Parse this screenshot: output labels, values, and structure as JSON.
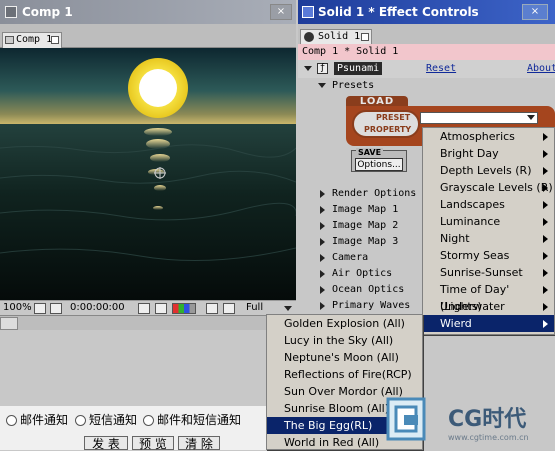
{
  "comp_window": {
    "title": "Comp 1",
    "tab_label": "Comp 1",
    "status": {
      "zoom": "100%",
      "timecode": "0:00:00:00",
      "resolution": "Full"
    }
  },
  "effect_controls": {
    "title": "Solid 1 * Effect Controls",
    "tab_label": "Solid 1",
    "comp_line": "Comp 1 * Solid 1",
    "effect_name": "Psunami",
    "reset_link": "Reset",
    "about_link": "About",
    "presets_label": "Presets",
    "preset_widget": {
      "load_label": "LOAD",
      "preset_label": "PRESET",
      "property_label": "PROPERTY",
      "save_label": "SAVE",
      "options_button": "Options..."
    },
    "properties": [
      "Render Options",
      "Image Map 1",
      "Image Map 2",
      "Image Map 3",
      "Camera",
      "Air Optics",
      "Ocean Optics",
      "Primary Waves"
    ]
  },
  "preset_menu": {
    "items": [
      "Atmospherics",
      "Bright Day",
      "Depth Levels (R)",
      "Grayscale Levels (R)",
      "Landscapes",
      "Luminance",
      "Night",
      "Stormy Seas",
      "Sunrise-Sunset",
      "Time of Day' (Lights)",
      "Underwater",
      "Wierd"
    ],
    "selected": "Wierd"
  },
  "wierd_submenu": {
    "items": [
      "Golden Explosion (All)",
      "Lucy in the Sky (All)",
      "Neptune's Moon (All)",
      "Reflections of Fire(RCP)",
      "Sun Over Mordor (All)",
      "Sunrise Bloom (All)",
      "The Big Egg(RL)",
      "World in Red (All)"
    ],
    "selected": "The Big Egg(RL)"
  },
  "notify": {
    "options": [
      "邮件通知",
      "短信通知",
      "邮件和短信通知"
    ],
    "buttons": [
      "发 表",
      "预 览",
      "清 除"
    ]
  },
  "watermark": {
    "brand": "CG时代",
    "url": "www.cgtime.com.cn"
  },
  "colors": {
    "ec_title": "#1e3c9a",
    "menu_highlight": "#0a246a",
    "preset_widget": "#a5451e",
    "comp_line_bg": "#f2c6cc"
  }
}
